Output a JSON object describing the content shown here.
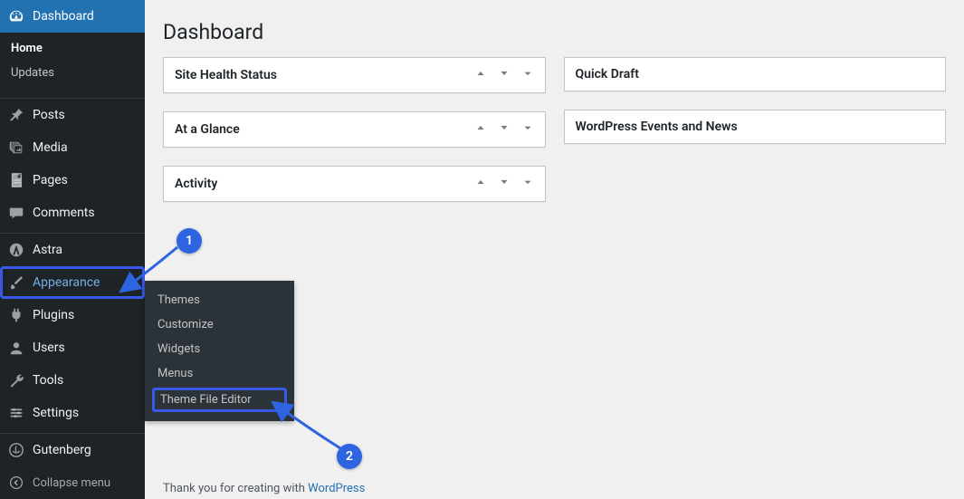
{
  "sidebar": {
    "dashboard": "Dashboard",
    "dashboard_sub": {
      "home": "Home",
      "updates": "Updates"
    },
    "posts": "Posts",
    "media": "Media",
    "pages": "Pages",
    "comments": "Comments",
    "astra": "Astra",
    "appearance": "Appearance",
    "plugins": "Plugins",
    "users": "Users",
    "tools": "Tools",
    "settings": "Settings",
    "gutenberg": "Gutenberg",
    "collapse": "Collapse menu"
  },
  "flyout": {
    "themes": "Themes",
    "customize": "Customize",
    "widgets": "Widgets",
    "menus": "Menus",
    "theme_file_editor": "Theme File Editor"
  },
  "page": {
    "title": "Dashboard"
  },
  "boxes": {
    "site_health": "Site Health Status",
    "at_a_glance": "At a Glance",
    "activity": "Activity",
    "quick_draft": "Quick Draft",
    "events": "WordPress Events and News"
  },
  "footer": {
    "thanks_prefix": "Thank you for creating with ",
    "wp": "WordPress"
  },
  "annotations": {
    "one": "1",
    "two": "2"
  }
}
